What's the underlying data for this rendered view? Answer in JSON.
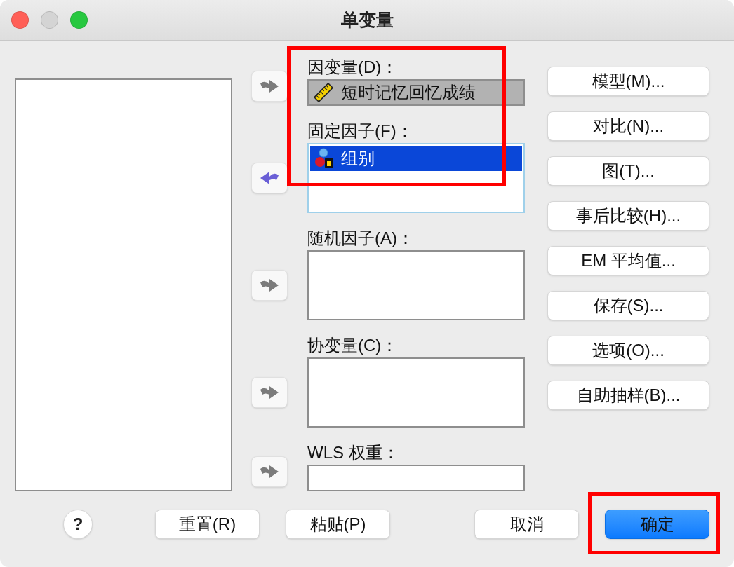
{
  "window": {
    "title": "单变量",
    "controls": [
      {
        "kind": "close",
        "disabled": false
      },
      {
        "kind": "minimize",
        "disabled": true
      },
      {
        "kind": "zoom",
        "disabled": false
      }
    ]
  },
  "fields": [
    {
      "label": "因变量(D)：",
      "kind": "single",
      "focused": false,
      "arrow": {
        "kind": "right",
        "disabled": true
      },
      "items": [
        {
          "text": "短时记忆回忆成绩",
          "kind": "scale",
          "selected": true
        }
      ]
    },
    {
      "label": "固定因子(F)：",
      "kind": "list",
      "focused": true,
      "arrow": {
        "kind": "left",
        "disabled": false
      },
      "items": [
        {
          "text": "组别",
          "kind": "nominal",
          "selected": true
        }
      ]
    },
    {
      "label": "随机因子(A)：",
      "kind": "list",
      "focused": false,
      "arrow": {
        "kind": "right",
        "disabled": true
      }
    },
    {
      "label": "协变量(C)：",
      "kind": "list",
      "focused": false,
      "arrow": {
        "kind": "right",
        "disabled": true
      }
    },
    {
      "label": "WLS 权重：",
      "kind": "single",
      "focused": false,
      "arrow": {
        "kind": "right",
        "disabled": true
      }
    }
  ],
  "side_buttons": [
    "模型(M)...",
    "对比(N)...",
    "图(T)...",
    "事后比较(H)...",
    "EM 平均值...",
    "保存(S)...",
    "选项(O)...",
    "自助抽样(B)..."
  ],
  "footer": {
    "help": "?",
    "buttons": [
      {
        "label": "重置(R)",
        "default": false
      },
      {
        "label": "粘贴(P)",
        "default": false
      },
      {
        "label": "取消",
        "default": false
      },
      {
        "label": "确定",
        "default": true
      }
    ]
  }
}
